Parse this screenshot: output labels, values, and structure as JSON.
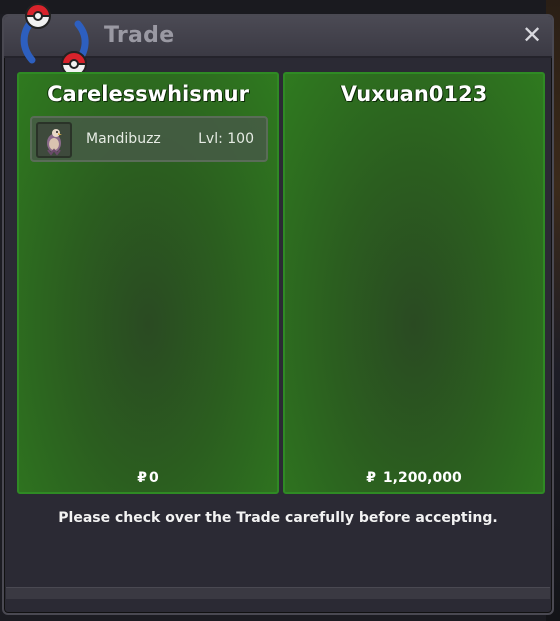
{
  "window": {
    "title": "Trade",
    "close_label": "✕"
  },
  "left_panel": {
    "player_name": "Carelesswhismur",
    "pokemon": [
      {
        "name": "Mandibuzz",
        "level": "Lvl: 100",
        "icon": "mandibuzz-sprite-icon"
      }
    ],
    "currency_symbol": "₽",
    "money": "0"
  },
  "right_panel": {
    "player_name": "Vuxuan0123",
    "pokemon": [],
    "currency_symbol": "₽",
    "money": "1,200,000"
  },
  "notice": "Please check over the Trade carefully before accepting.",
  "colors": {
    "panel_border": "#2f8a24",
    "panel_fill": "#2b5e1f",
    "window_bg": "#2b2a34",
    "title_text": "#9a99a3"
  }
}
